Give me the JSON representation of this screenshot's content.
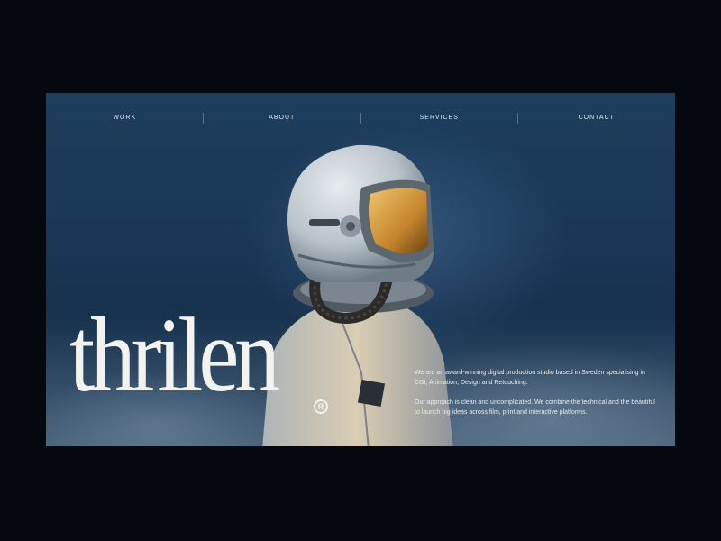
{
  "nav": {
    "items": [
      {
        "label": "WORK"
      },
      {
        "label": "ABOUT"
      },
      {
        "label": "SERVICES"
      },
      {
        "label": "CONTACT"
      }
    ]
  },
  "hero": {
    "brand": "thrilen",
    "registered_mark": "R",
    "paragraphs": [
      "We are an award-winning digital production studio based in Sweden specialising in CGI, Animation, Design and Retouching.",
      "Our approach is clean and uncomplicated. We combine the technical and the beautiful to launch big ideas across film, print and interactive platforms."
    ]
  },
  "colors": {
    "page_background": "#05080f",
    "hero_blue": "#1d3e5c",
    "text_light": "#f2f2ef",
    "visor_amber": "#d9a24a"
  }
}
